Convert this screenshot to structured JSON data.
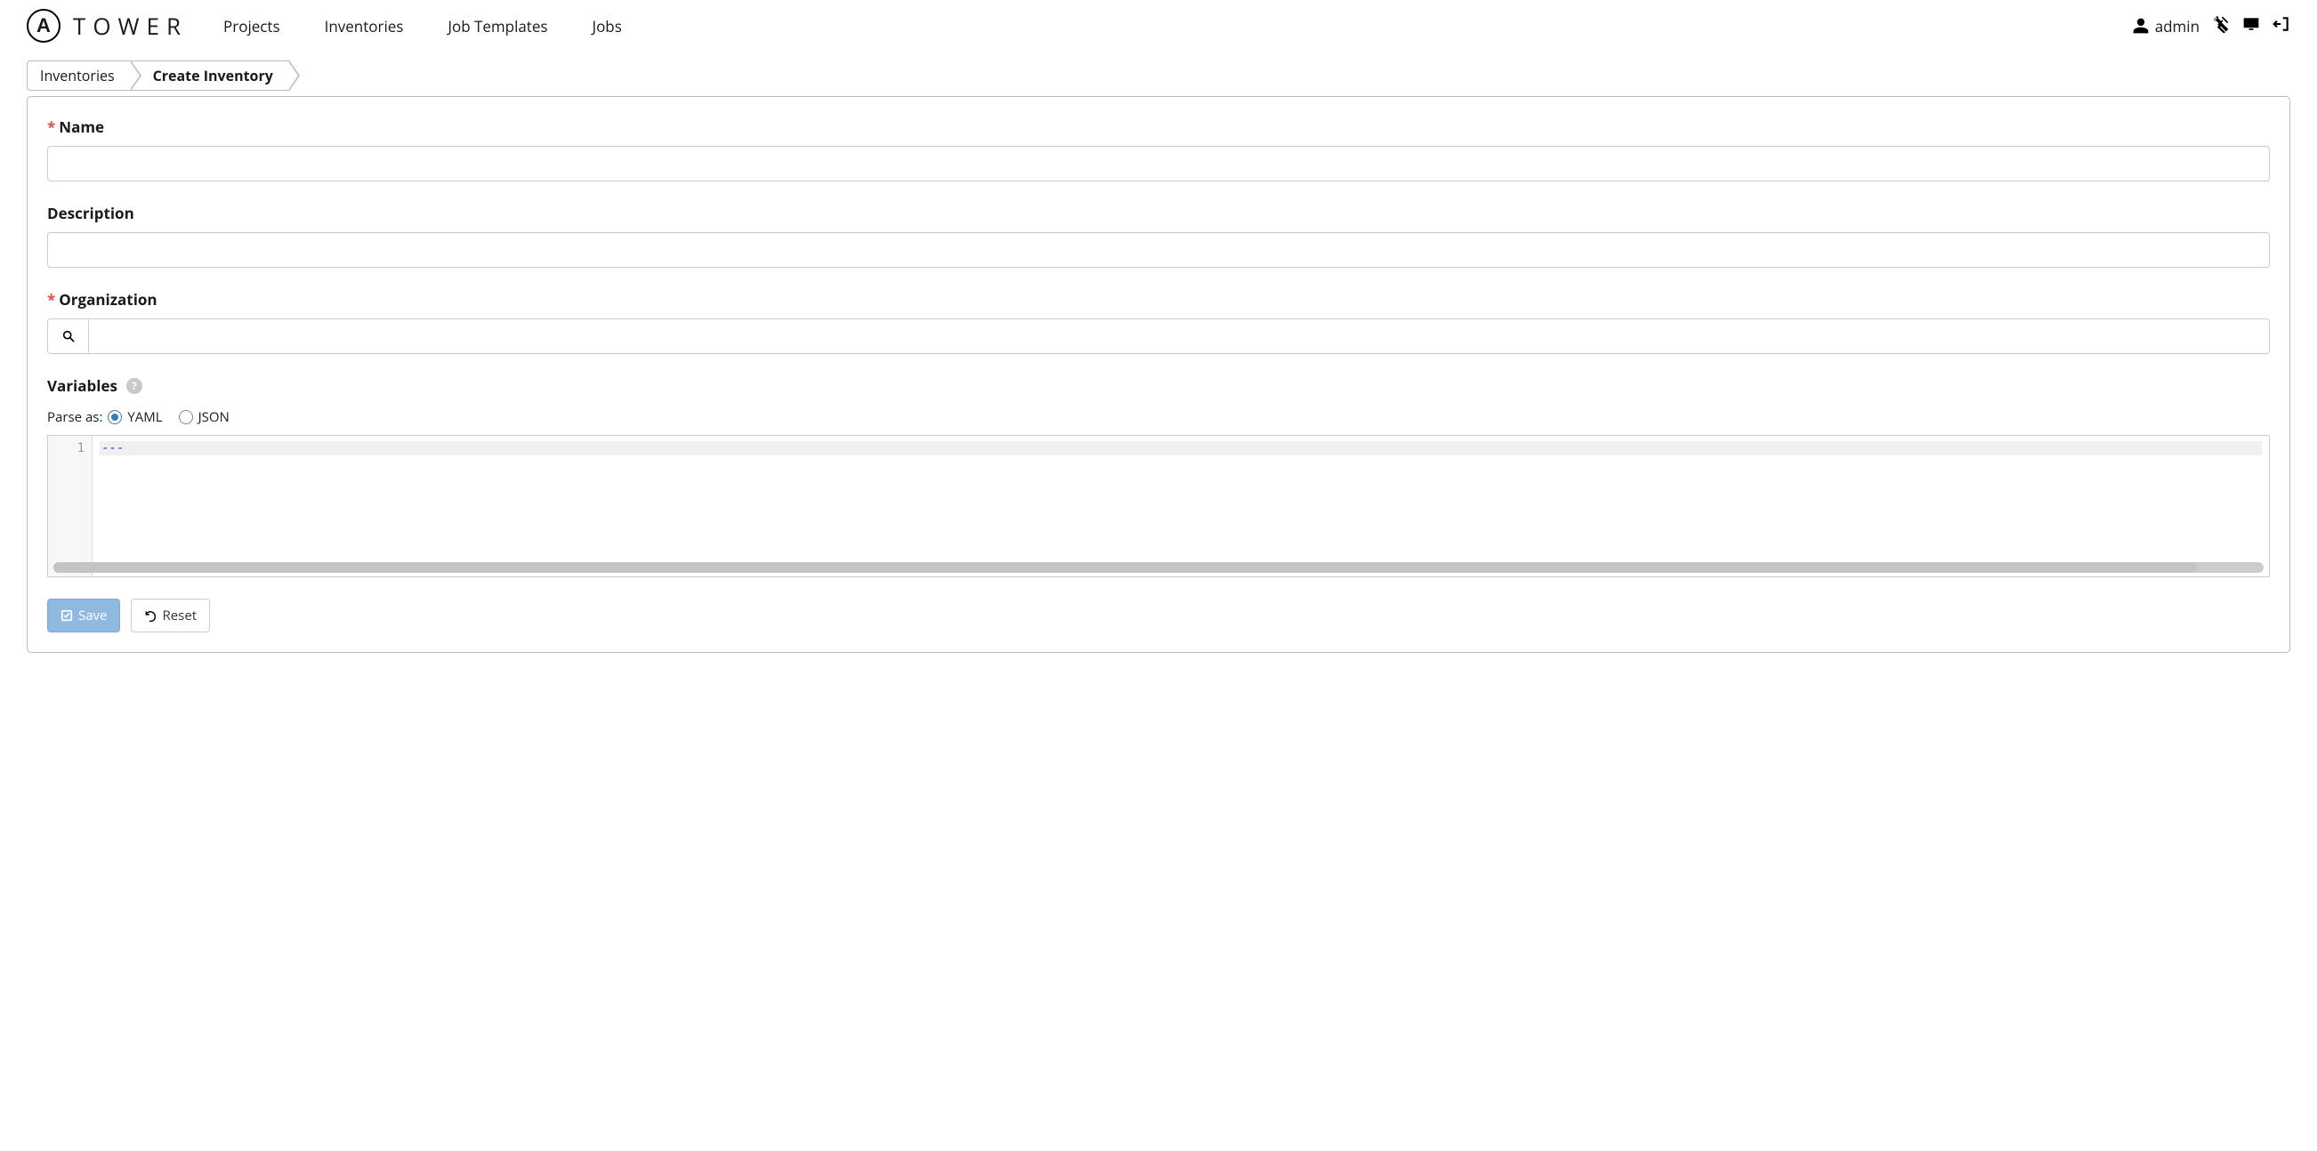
{
  "brand": {
    "letter": "A",
    "name": "TOWER"
  },
  "nav": [
    "Projects",
    "Inventories",
    "Job Templates",
    "Jobs"
  ],
  "user": "admin",
  "breadcrumb": {
    "first": "Inventories",
    "second": "Create Inventory"
  },
  "form": {
    "name_label": "Name",
    "description_label": "Description",
    "organization_label": "Organization",
    "variables_label": "Variables",
    "parse_as_label": "Parse as:",
    "yaml_label": "YAML",
    "json_label": "JSON",
    "name_value": "",
    "description_value": "",
    "organization_value": ""
  },
  "editor": {
    "line_number": "1",
    "content": "---"
  },
  "buttons": {
    "save": "Save",
    "reset": "Reset"
  }
}
